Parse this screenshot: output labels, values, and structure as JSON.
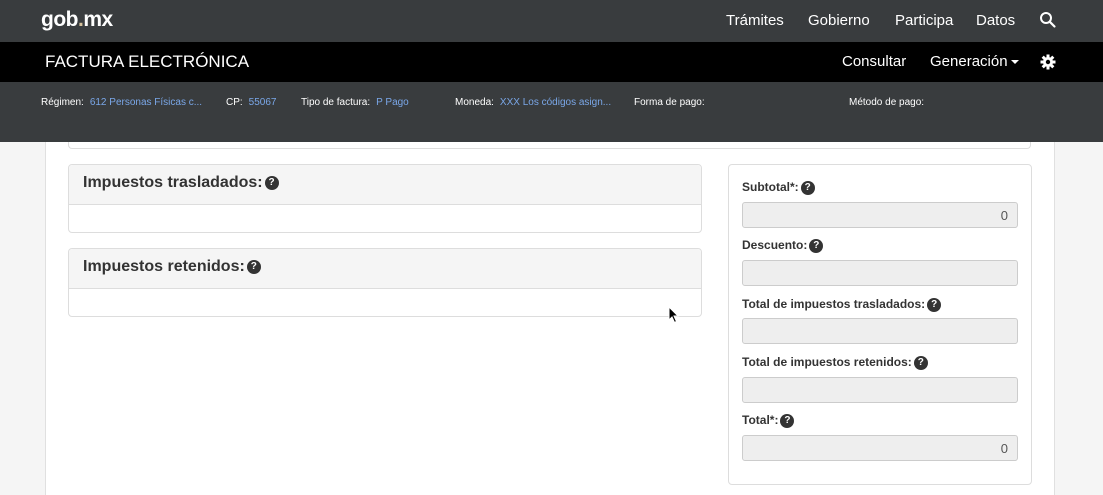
{
  "top": {
    "brand_a": "gob",
    "brand_dot": ".",
    "brand_b": "mx",
    "nav": [
      "Trámites",
      "Gobierno",
      "Participa",
      "Datos"
    ]
  },
  "app": {
    "title": "FACTURA ELECTRÓNICA",
    "consultar": "Consultar",
    "generacion": "Generación"
  },
  "info": {
    "regimen_label": "Régimen:",
    "regimen_value": "612 Personas Físicas c...",
    "cp_label": "CP:",
    "cp_value": "55067",
    "tipo_label": "Tipo de factura:",
    "tipo_value": "P Pago",
    "moneda_label": "Moneda:",
    "moneda_value": "XXX Los códigos asign...",
    "forma_label": "Forma de pago:",
    "metodo_label": "Método de pago:"
  },
  "panels": {
    "trasladados": "Impuestos trasladados:",
    "retenidos": "Impuestos retenidos:"
  },
  "totals": {
    "subtotal_label": "Subtotal*:",
    "subtotal_value": "0",
    "descuento_label": "Descuento:",
    "descuento_value": "",
    "tras_label": "Total de impuestos trasladados:",
    "tras_value": "",
    "ret_label": "Total de impuestos retenidos:",
    "ret_value": "",
    "total_label": "Total*:",
    "total_value": "0"
  },
  "icons": {
    "help": "?"
  },
  "colors": {
    "topbar": "#393c3e",
    "appbar": "#000000",
    "info_value": "#7aa7e8",
    "brand_dot": "#d4c19c"
  }
}
